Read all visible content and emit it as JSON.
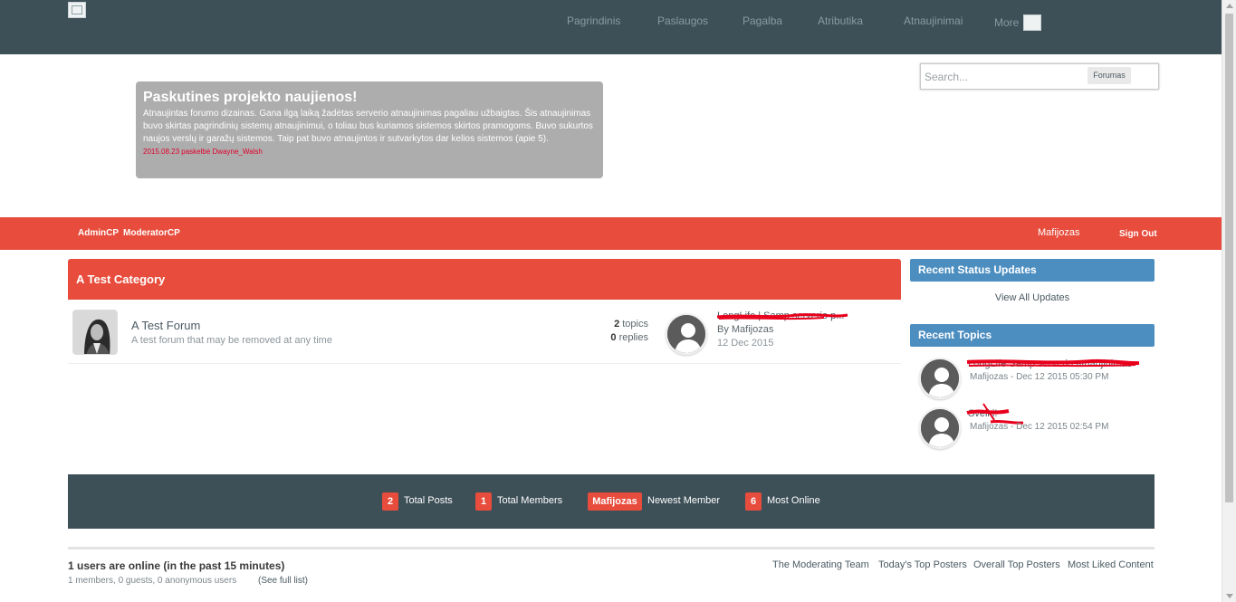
{
  "nav": {
    "items": [
      "Pagrindinis",
      "Paslaugos",
      "Pagalba",
      "Atributika",
      "Atnaujinimai",
      "More"
    ]
  },
  "news": {
    "title": "Paskutines projekto naujienos!",
    "body": "Atnaujintas forumo dizainas. Gana ilgą laiką žadėtas serverio atnaujinimas pagaliau užbaigtas. Šis atnaujinimas buvo skirtas pagrindinių sistemų atnaujinimui, o toliau bus kuriamos sistemos skirtos pramogoms. Buvo sukurtos naujos verslų ir garažų sistemos. Taip pat buvo atnaujintos ir sutvarkytos dar kelios sistemos (apie 5).",
    "meta": "2015.08.23 paskelbė Dwayne_Walsh"
  },
  "search": {
    "placeholder": "Search...",
    "scope": "Forumas"
  },
  "userbar": {
    "admincp": "AdminCP",
    "modcp": "ModeratorCP",
    "username": "Mafijozas",
    "signout": "Sign Out"
  },
  "category": {
    "title": "A Test Category",
    "forum": {
      "name": "A Test Forum",
      "description": "A test forum that may be removed at any time",
      "topics_count": "2",
      "topics_label": "topics",
      "replies_count": "0",
      "replies_label": "replies",
      "last_post_title": "LongLife | Samp serverio p...",
      "last_post_by": "By Mafijozas",
      "last_post_date": "12 Dec 2015"
    }
  },
  "sidebar": {
    "status_title": "Recent Status Updates",
    "view_all": "View All Updates",
    "topics_title": "Recent Topics",
    "topics": [
      {
        "title": "LongLife Samp serverio atnaujinimas",
        "meta": "Mafijozas - Dec 12 2015 05:30 PM"
      },
      {
        "title": "Sveiki!",
        "meta": "Mafijozas - Dec 12 2015 02:54 PM"
      }
    ]
  },
  "stats": {
    "total_posts": "2",
    "total_posts_label": "Total Posts",
    "total_members": "1",
    "total_members_label": "Total Members",
    "newest_member": "Mafijozas",
    "newest_member_label": "Newest Member",
    "most_online": "6",
    "most_online_label": "Most Online"
  },
  "footer": {
    "online_title": "1 users are online (in the past 15 minutes)",
    "online_sub": "1 members, 0 guests, 0 anonymous users",
    "full_list": "(See full list)",
    "links": [
      "The Moderating Team",
      "Today's Top Posters",
      "Overall Top Posters",
      "Most Liked Content"
    ]
  },
  "colors": {
    "topbar": "#3d4f57",
    "accent_red": "#e74c3c",
    "accent_blue": "#4c8ec0",
    "news_bg": "#adadad"
  }
}
